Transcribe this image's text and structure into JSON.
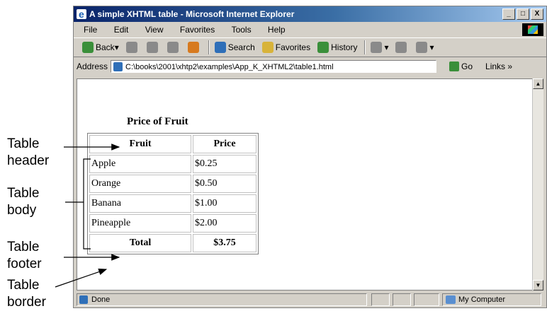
{
  "window": {
    "title": "A simple XHTML table - Microsoft Internet Explorer",
    "controls": {
      "minimize": "_",
      "maximize": "□",
      "close": "X"
    }
  },
  "menu": [
    "File",
    "Edit",
    "View",
    "Favorites",
    "Tools",
    "Help"
  ],
  "toolbar": {
    "back": "Back",
    "search": "Search",
    "favorites": "Favorites",
    "history": "History"
  },
  "address": {
    "label": "Address",
    "value": "C:\\books\\2001\\xhtp2\\examples\\App_K_XHTML2\\table1.html",
    "go": "Go",
    "links": "Links »"
  },
  "page": {
    "caption": "Price of Fruit",
    "header": {
      "col1": "Fruit",
      "col2": "Price"
    },
    "rows": [
      {
        "fruit": "Apple",
        "price": "$0.25"
      },
      {
        "fruit": "Orange",
        "price": "$0.50"
      },
      {
        "fruit": "Banana",
        "price": "$1.00"
      },
      {
        "fruit": "Pineapple",
        "price": "$2.00"
      }
    ],
    "footer": {
      "col1": "Total",
      "col2": "$3.75"
    }
  },
  "status": {
    "text": "Done",
    "zone": "My Computer"
  },
  "annotations": {
    "table_header": [
      "Table",
      "header"
    ],
    "table_body": [
      "Table",
      "body"
    ],
    "table_footer": [
      "Table",
      "footer"
    ],
    "table_border": [
      "Table",
      "border"
    ]
  }
}
